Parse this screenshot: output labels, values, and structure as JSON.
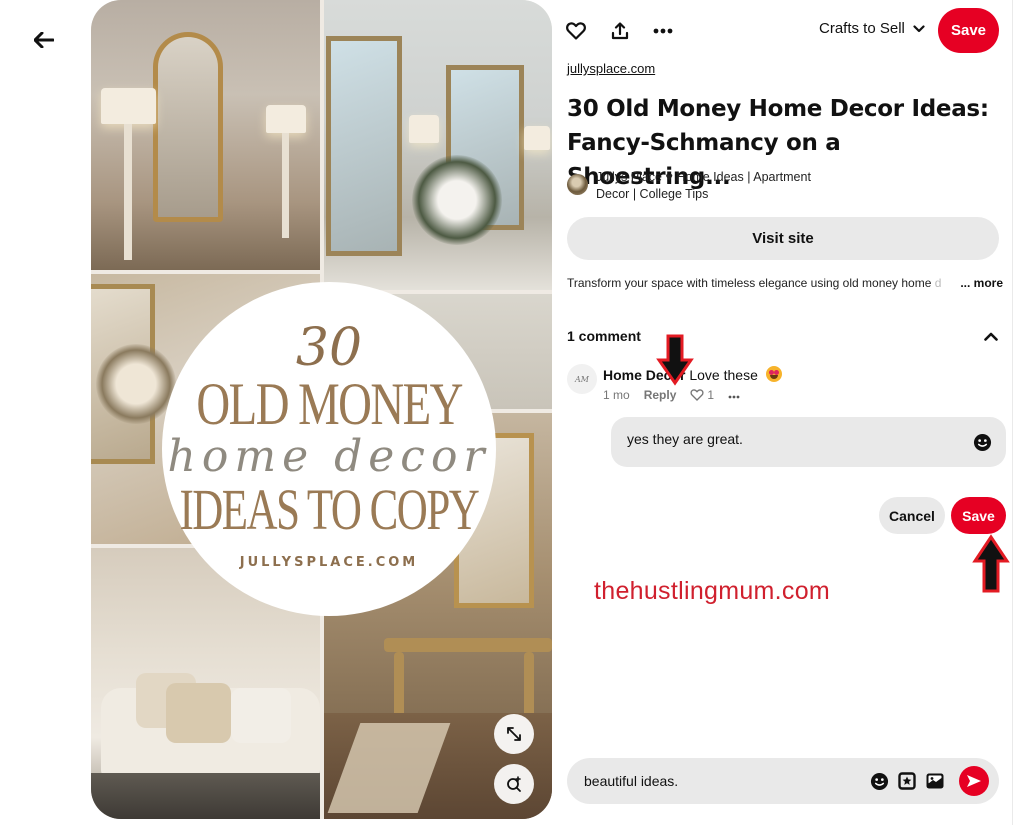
{
  "nav": {
    "back_icon": "arrow-left-icon"
  },
  "pin_image": {
    "overlay_number": "30",
    "overlay_line1": "OLD MONEY",
    "overlay_script": "home decor",
    "overlay_line2": "IDEAS TO COPY",
    "overlay_site": "JULLYSPLACE.COM",
    "controls": [
      {
        "icon": "expand-icon"
      },
      {
        "icon": "visual-search-icon"
      }
    ]
  },
  "toolbar": {
    "icons": [
      "heart-icon",
      "share-icon",
      "more-icon"
    ],
    "board_label": "Crafts to Sell",
    "save_label": "Save"
  },
  "pin": {
    "source": "jullysplace.com",
    "title": "30 Old Money Home Decor Ideas: Fancy-Schmancy on a Shoestring...",
    "creator": "Jullys Place ♥ Home Ideas | Apartment Decor | College Tips",
    "visit_label": "Visit site",
    "description": "Transform your space with timeless elegance using old money home",
    "description_fade": " d",
    "more_label": "... more"
  },
  "comments": {
    "header": "1 comment",
    "items": [
      {
        "avatar_initials": "AM",
        "author": "Home Decor",
        "text": "Love these",
        "emoji": "heart-eyes",
        "age": "1 mo",
        "reply_label": "Reply",
        "likes": "1"
      }
    ],
    "reply_value": "yes they are great.",
    "cancel_label": "Cancel",
    "save_label": "Save"
  },
  "watermark": "thehustlingmum.com",
  "composer": {
    "value": "beautiful ideas.",
    "icons": [
      "emoji-icon",
      "sticker-icon",
      "image-icon",
      "send-icon"
    ]
  },
  "colors": {
    "brand_red": "#e60023",
    "watermark_red": "#d0202e",
    "pill_gray": "#e9e9e9"
  }
}
